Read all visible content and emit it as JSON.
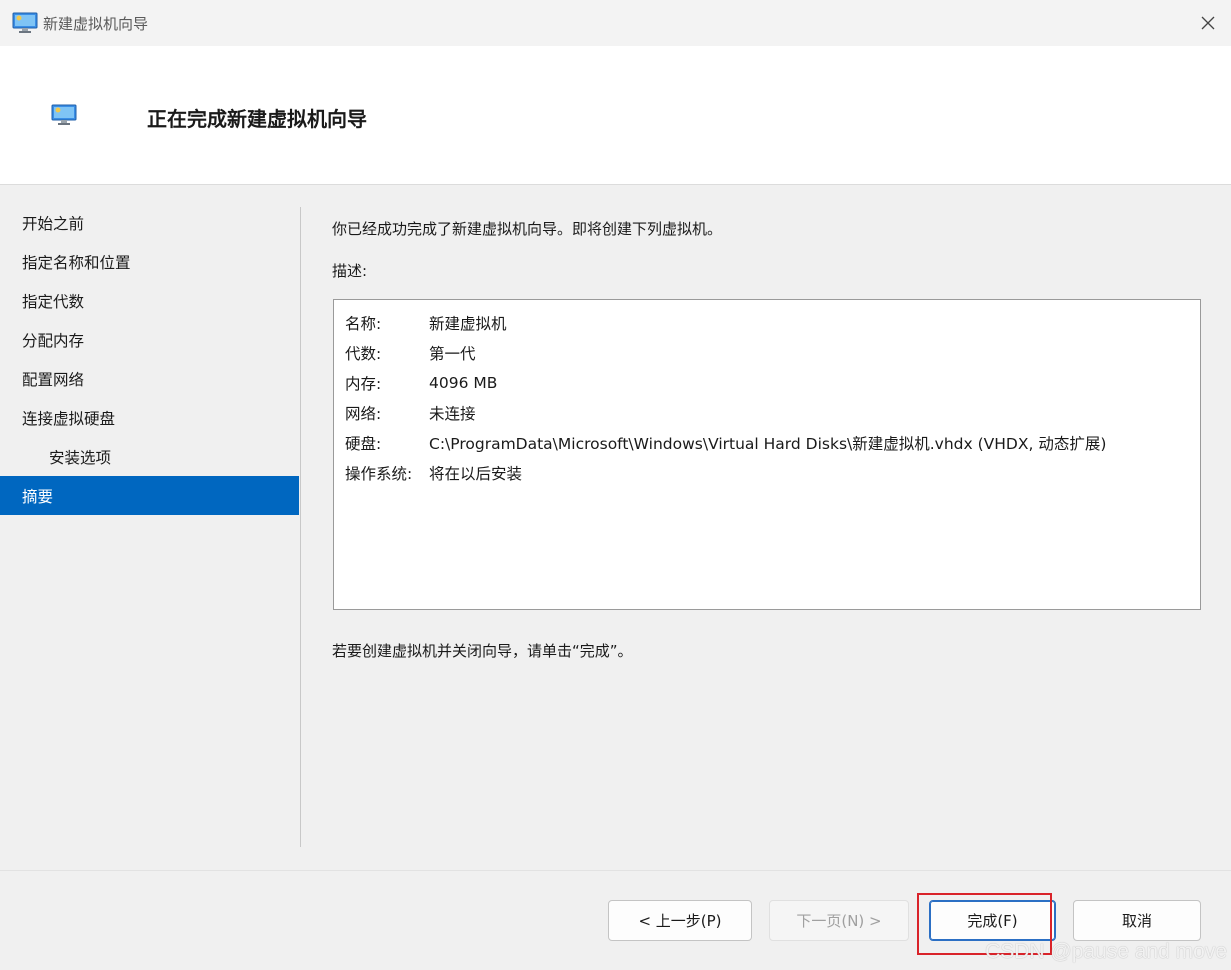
{
  "window": {
    "title": "新建虚拟机向导"
  },
  "header": {
    "heading": "正在完成新建虚拟机向导"
  },
  "steps": [
    {
      "label": "开始之前"
    },
    {
      "label": "指定名称和位置"
    },
    {
      "label": "指定代数"
    },
    {
      "label": "分配内存"
    },
    {
      "label": "配置网络"
    },
    {
      "label": "连接虚拟硬盘"
    },
    {
      "label": "安装选项"
    },
    {
      "label": "摘要"
    }
  ],
  "main": {
    "intro": "你已经成功完成了新建虚拟机向导。即将创建下列虚拟机。",
    "desc_label": "描述:",
    "summary": [
      {
        "key": "名称:",
        "value": "新建虚拟机"
      },
      {
        "key": "代数:",
        "value": "第一代"
      },
      {
        "key": "内存:",
        "value": "4096 MB"
      },
      {
        "key": "网络:",
        "value": "未连接"
      },
      {
        "key": "硬盘:",
        "value": "C:\\ProgramData\\Microsoft\\Windows\\Virtual Hard Disks\\新建虚拟机.vhdx (VHDX, 动态扩展)"
      },
      {
        "key": "操作系统:",
        "value": "将在以后安装"
      }
    ],
    "footer_note": "若要创建虚拟机并关闭向导，请单击“完成”。"
  },
  "buttons": {
    "prev": "< 上一步(P)",
    "next": "下一页(N) >",
    "finish": "完成(F)",
    "cancel": "取消"
  },
  "watermark": "CSDN @pause and move",
  "colors": {
    "accent": "#0067c0",
    "highlight": "#d9232a"
  }
}
